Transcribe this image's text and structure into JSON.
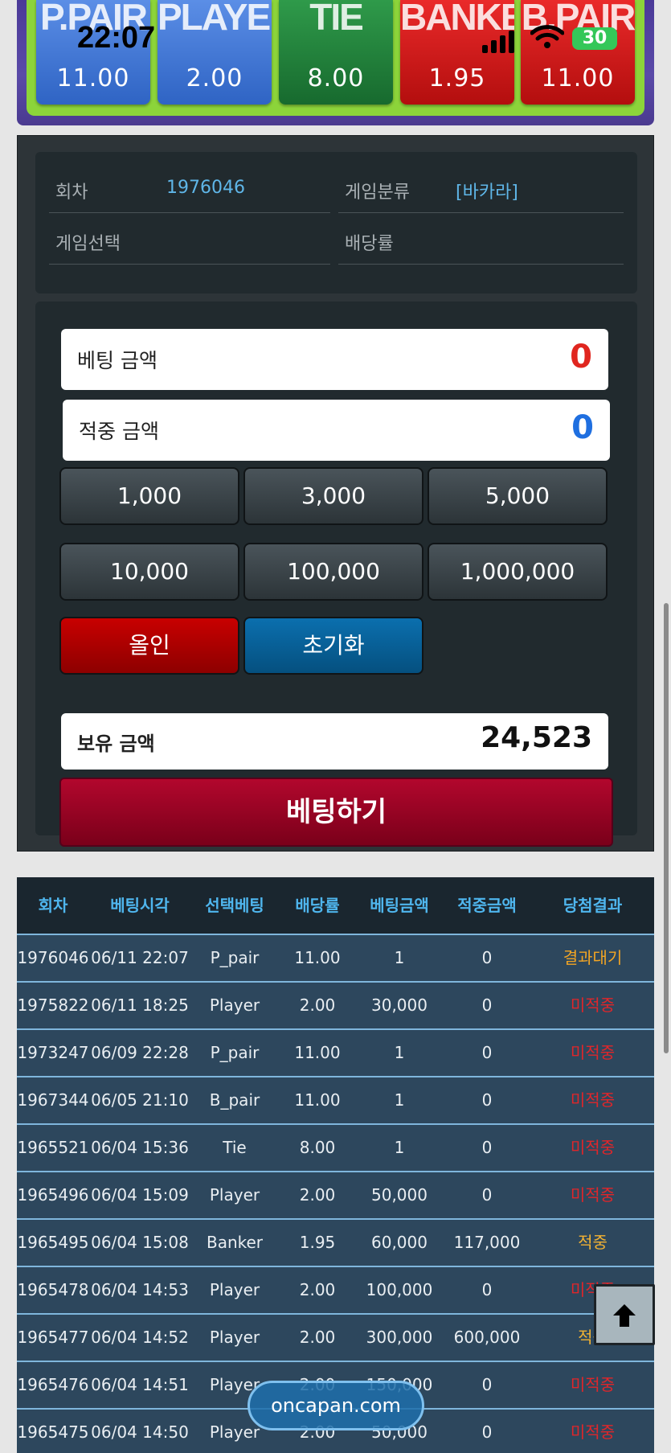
{
  "status_bar": {
    "time": "22:07",
    "battery": "30"
  },
  "bet_board": [
    {
      "name": "P.PAIR",
      "odds": "11.00",
      "color": "#3f74d4"
    },
    {
      "name": "PLAYER",
      "odds": "2.00",
      "color": "#3f74d4"
    },
    {
      "name": "TIE",
      "odds": "8.00",
      "color": "#1e7a36"
    },
    {
      "name": "BANKER",
      "odds": "1.95",
      "color": "#cc1212"
    },
    {
      "name": "B.PAIR",
      "odds": "11.00",
      "color": "#cc1212"
    }
  ],
  "info": {
    "round_label": "회차",
    "round_value": "1976046",
    "category_label": "게임분류",
    "category_value": "[바카라]",
    "selection_label": "게임선택",
    "selection_value": "",
    "odds_label": "배당률",
    "odds_value": ""
  },
  "bet_form": {
    "bet_amount_label": "베팅 금액",
    "bet_amount_value": "0",
    "win_amount_label": "적중 금액",
    "win_amount_value": "0",
    "chips": [
      "1,000",
      "3,000",
      "5,000",
      "10,000",
      "100,000",
      "1,000,000"
    ],
    "allin_label": "올인",
    "reset_label": "초기화",
    "balance_label": "보유 금액",
    "balance_value": "24,523",
    "submit_label": "베팅하기"
  },
  "history": {
    "columns": [
      "회차",
      "베팅시각",
      "선택베팅",
      "배당률",
      "베팅금액",
      "적중금액",
      "당첨결과"
    ],
    "rows": [
      [
        "1976046",
        "06/11 22:07",
        "P_pair",
        "11.00",
        "1",
        "0",
        "결과대기"
      ],
      [
        "1975822",
        "06/11 18:25",
        "Player",
        "2.00",
        "30,000",
        "0",
        "미적중"
      ],
      [
        "1973247",
        "06/09 22:28",
        "P_pair",
        "11.00",
        "1",
        "0",
        "미적중"
      ],
      [
        "1967344",
        "06/05 21:10",
        "B_pair",
        "11.00",
        "1",
        "0",
        "미적중"
      ],
      [
        "1965521",
        "06/04 15:36",
        "Tie",
        "8.00",
        "1",
        "0",
        "미적중"
      ],
      [
        "1965496",
        "06/04 15:09",
        "Player",
        "2.00",
        "50,000",
        "0",
        "미적중"
      ],
      [
        "1965495",
        "06/04 15:08",
        "Banker",
        "1.95",
        "60,000",
        "117,000",
        "적중"
      ],
      [
        "1965478",
        "06/04 14:53",
        "Player",
        "2.00",
        "100,000",
        "0",
        "미적중"
      ],
      [
        "1965477",
        "06/04 14:52",
        "Player",
        "2.00",
        "300,000",
        "600,000",
        "적중"
      ],
      [
        "1965476",
        "06/04 14:51",
        "Player",
        "2.00",
        "150,000",
        "0",
        "미적중"
      ],
      [
        "1965475",
        "06/04 14:50",
        "Player",
        "2.00",
        "50,000",
        "0",
        "미적중"
      ]
    ]
  },
  "overlay": {
    "scroll_top_icon": "arrow-up-icon",
    "site_badge": "oncapan.com"
  }
}
